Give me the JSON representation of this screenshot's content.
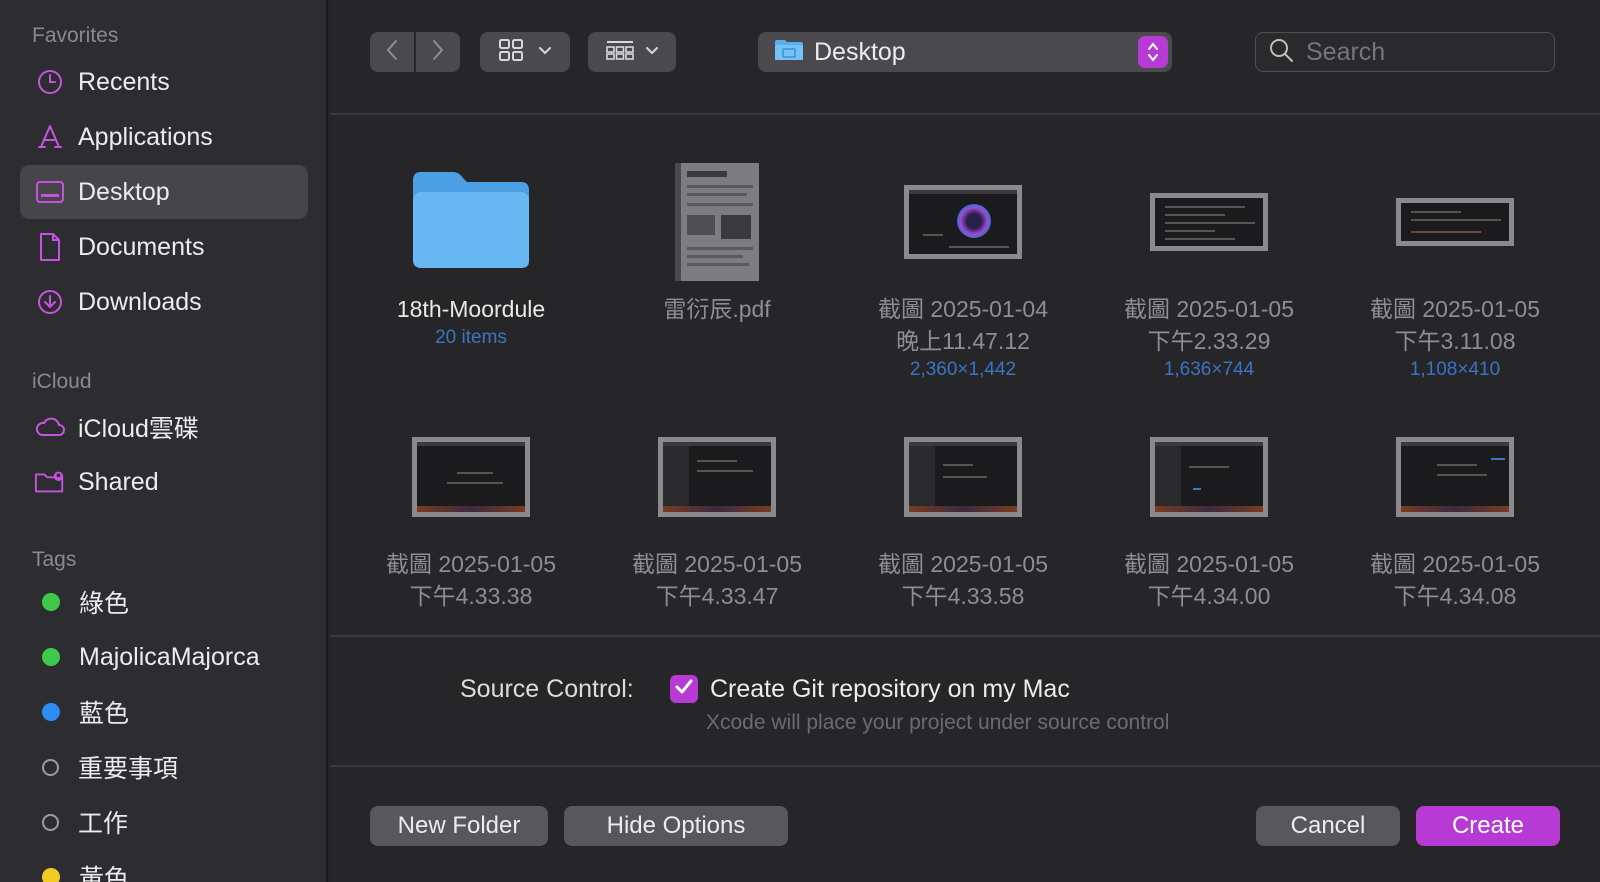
{
  "sidebar": {
    "favorites_title": "Favorites",
    "favorites": [
      {
        "label": "Recents",
        "icon": "clock-icon"
      },
      {
        "label": "Applications",
        "icon": "applications-icon"
      },
      {
        "label": "Desktop",
        "icon": "desktop-icon",
        "selected": true
      },
      {
        "label": "Documents",
        "icon": "document-icon"
      },
      {
        "label": "Downloads",
        "icon": "download-icon"
      }
    ],
    "icloud_title": "iCloud",
    "icloud": [
      {
        "label": "iCloud雲碟",
        "icon": "cloud-icon"
      },
      {
        "label": "Shared",
        "icon": "shared-folder-icon"
      }
    ],
    "tags_title": "Tags",
    "tags": [
      {
        "label": "綠色",
        "color": "#3ec94a"
      },
      {
        "label": "MajolicaMajorca",
        "color": "#3ec94a"
      },
      {
        "label": "藍色",
        "color": "#2f8cf2"
      },
      {
        "label": "重要事項",
        "color": ""
      },
      {
        "label": "工作",
        "color": ""
      },
      {
        "label": "黃色",
        "color": "#f1cb24"
      }
    ]
  },
  "toolbar": {
    "location": "Desktop",
    "search_placeholder": "Search"
  },
  "files": [
    {
      "name": "18th-Moordule",
      "meta": "20 items",
      "kind": "folder"
    },
    {
      "name": "雷衍辰.pdf",
      "meta": "",
      "kind": "pdf"
    },
    {
      "name": "截圖 2025-01-04",
      "name2": "晚上11.47.12",
      "meta": "2,360×1,442",
      "kind": "shot"
    },
    {
      "name": "截圖 2025-01-05",
      "name2": "下午2.33.29",
      "meta": "1,636×744",
      "kind": "shot"
    },
    {
      "name": "截圖 2025-01-05",
      "name2": "下午3.11.08",
      "meta": "1,108×410",
      "kind": "shot"
    },
    {
      "name": "截圖 2025-01-05",
      "name2": "下午4.33.38",
      "meta": "",
      "kind": "shot"
    },
    {
      "name": "截圖 2025-01-05",
      "name2": "下午4.33.47",
      "meta": "",
      "kind": "shot"
    },
    {
      "name": "截圖 2025-01-05",
      "name2": "下午4.33.58",
      "meta": "",
      "kind": "shot"
    },
    {
      "name": "截圖 2025-01-05",
      "name2": "下午4.34.00",
      "meta": "",
      "kind": "shot"
    },
    {
      "name": "截圖 2025-01-05",
      "name2": "下午4.34.08",
      "meta": "",
      "kind": "shot"
    }
  ],
  "options": {
    "source_control_label": "Source Control:",
    "git_checkbox_label": "Create Git repository on my Mac",
    "git_checked": true,
    "hint": "Xcode will place your project under source control"
  },
  "buttons": {
    "new_folder": "New Folder",
    "hide_options": "Hide Options",
    "cancel": "Cancel",
    "create": "Create"
  },
  "colors": {
    "accent": "#b73ad4",
    "sidebar_icon": "#c653e0",
    "meta_text": "#3a74c5"
  }
}
